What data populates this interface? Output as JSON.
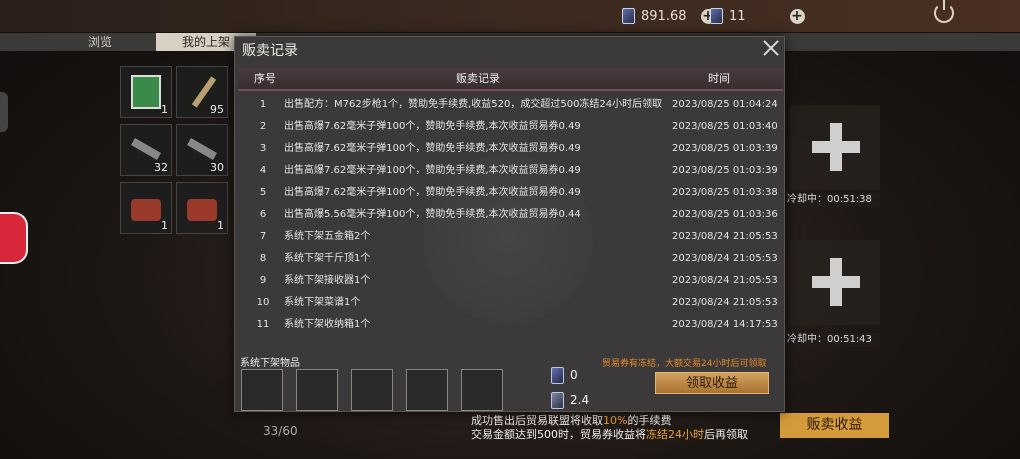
{
  "topbar": {
    "currency1": "891.68",
    "currency2": "11"
  },
  "tabs": {
    "browse": "浏览",
    "my_listings": "我的上架"
  },
  "inventory": [
    {
      "count": "1",
      "icon": "green-card-icon"
    },
    {
      "count": "95",
      "icon": "bullet-icon"
    },
    {
      "count": "32",
      "icon": "rifle-icon"
    },
    {
      "count": "30",
      "icon": "rifle-icon"
    },
    {
      "count": "1",
      "icon": "crate-icon"
    },
    {
      "count": "1",
      "icon": "crate-icon"
    }
  ],
  "right_slots": {
    "cooldown1": "冷却中：00:51:38",
    "cooldown2": "冷却中：00:51:43"
  },
  "background": {
    "count": "33/60",
    "info_line1_a": "成功售出后贸易联盟将收取",
    "info_line1_pct": "10%",
    "info_line1_b": "的手续费",
    "info_line2_a": "交易金额达到500时，贸易券收益将",
    "info_line2_hl": "冻结24小时",
    "info_line2_b": "后再领取",
    "sell_income_button": "贩卖收益"
  },
  "modal": {
    "title": "贩卖记录",
    "headers": {
      "no": "序号",
      "record": "贩卖记录",
      "time": "时间"
    },
    "rows": [
      {
        "no": "1",
        "record": "出售配方：M762步枪1个，赞助免手续费,收益520，成交超过500冻结24小时后领取",
        "time": "2023/08/25 01:04:24"
      },
      {
        "no": "2",
        "record": "出售高爆7.62毫米子弹100个，赞助免手续费,本次收益贸易券0.49",
        "time": "2023/08/25 01:03:40"
      },
      {
        "no": "3",
        "record": "出售高爆7.62毫米子弹100个，赞助免手续费,本次收益贸易券0.49",
        "time": "2023/08/25 01:03:39"
      },
      {
        "no": "4",
        "record": "出售高爆7.62毫米子弹100个，赞助免手续费,本次收益贸易券0.49",
        "time": "2023/08/25 01:03:39"
      },
      {
        "no": "5",
        "record": "出售高爆7.62毫米子弹100个，赞助免手续费,本次收益贸易券0.49",
        "time": "2023/08/25 01:03:38"
      },
      {
        "no": "6",
        "record": "出售高爆5.56毫米子弹100个，赞助免手续费,本次收益贸易券0.44",
        "time": "2023/08/25 01:03:36"
      },
      {
        "no": "7",
        "record": "系统下架五金箱2个",
        "time": "2023/08/24 21:05:53"
      },
      {
        "no": "8",
        "record": "系统下架千斤顶1个",
        "time": "2023/08/24 21:05:53"
      },
      {
        "no": "9",
        "record": "系统下架接收器1个",
        "time": "2023/08/24 21:05:53"
      },
      {
        "no": "10",
        "record": "系统下架菜谱1个",
        "time": "2023/08/24 21:05:53"
      },
      {
        "no": "11",
        "record": "系统下架收纳箱1个",
        "time": "2023/08/24 14:17:53"
      }
    ],
    "system_delisted_label": "系统下架物品",
    "freeze_note": "贸易券有冻结，大额交易24小时后可领取",
    "ticket_frozen": "0",
    "ticket_balance": "2.4",
    "claim_button": "领取收益"
  }
}
